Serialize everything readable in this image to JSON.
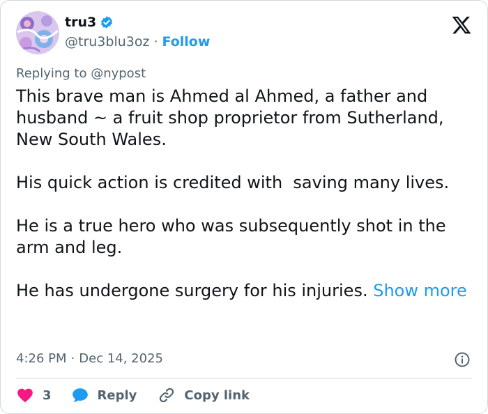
{
  "user": {
    "name": "tru3",
    "handle": "@tru3blu3oz",
    "separator": "·",
    "follow_label": "Follow"
  },
  "tweet": {
    "replying_to": "Replying to @nypost",
    "text": "This brave man is Ahmed al Ahmed, a father and husband ~ a fruit shop proprietor from Sutherland, New South Wales.\n\nHis quick action is credited with  saving many lives.\n\nHe is a true hero who was subsequently shot in the arm and leg.\n\nHe has undergone surgery for his injuries. ",
    "show_more": "Show more",
    "time": "4:26 PM",
    "separator": "·",
    "date": "Dec 14, 2025"
  },
  "actions": {
    "like_count": "3",
    "reply_label": "Reply",
    "copy_label": "Copy link"
  },
  "colors": {
    "accent": "#1d9bf0",
    "like": "#f91880",
    "secondary_text": "#536471",
    "border": "#cfd9de"
  },
  "icons": [
    "verified-badge-icon",
    "x-logo-icon",
    "info-icon",
    "heart-icon",
    "reply-bubble-icon",
    "link-icon"
  ]
}
